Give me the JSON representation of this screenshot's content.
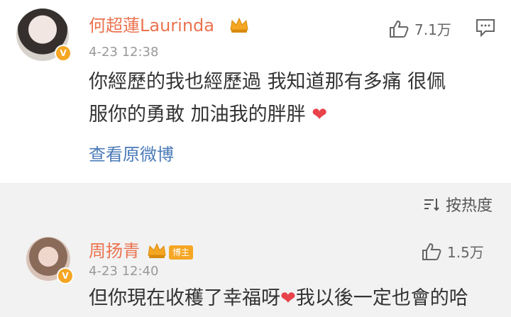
{
  "comments": [
    {
      "username": "何超蓮Laurinda",
      "timestamp": "4-23 12:38",
      "likes": "7.1万",
      "text_line1": "你經歷的我也經歷過 我知道那有多痛 很佩",
      "text_line2": "服你的勇敢 加油我的胖胖",
      "link": "查看原微博"
    },
    {
      "username": "周扬青",
      "role_badge": "博主",
      "timestamp": "4-23 12:40",
      "likes": "1.5万",
      "text_part1": "但你現在收穫了幸福呀",
      "text_part2": "我以後一定也會的哈"
    }
  ],
  "sort": {
    "label": "按热度"
  },
  "icons": {
    "like": "thumbs-up-icon",
    "comment": "comment-icon",
    "verify": "verified-badge-icon",
    "crown": "crown-icon",
    "sort": "sort-icon",
    "heart": "heart-icon"
  },
  "colors": {
    "username": "#eb7350",
    "link": "#4a7bb8",
    "heart": "#e8424b",
    "badge": "#f5a623"
  }
}
